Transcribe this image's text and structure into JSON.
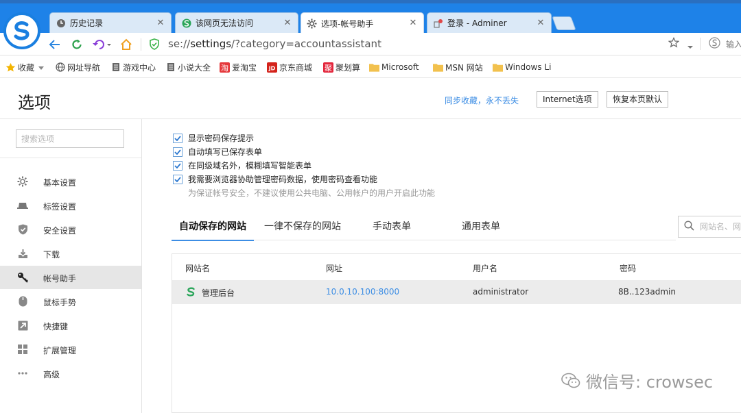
{
  "tabs": [
    {
      "title": "历史记录",
      "icon": "history-clock-icon",
      "active": false
    },
    {
      "title": "该网页无法访问",
      "icon": "sogou-s-icon",
      "active": false
    },
    {
      "title": "选项-帐号助手",
      "icon": "gear-icon",
      "active": true
    },
    {
      "title": "登录 - Adminer",
      "icon": "adminer-icon",
      "active": false
    }
  ],
  "address": {
    "scheme": "se://",
    "host": "settings",
    "path": "/?category=accountassistant"
  },
  "search_hint": "输入",
  "bookmarks": [
    {
      "label": "收藏",
      "icon": "star-icon"
    },
    {
      "label": "网址导航",
      "icon": "globe-icon"
    },
    {
      "label": "游戏中心",
      "icon": "page-icon"
    },
    {
      "label": "小说大全",
      "icon": "page-icon"
    },
    {
      "label": "爱淘宝",
      "icon": "taobao-icon"
    },
    {
      "label": "京东商城",
      "icon": "jd-icon"
    },
    {
      "label": "聚划算",
      "icon": "juhuasuan-icon"
    },
    {
      "label": "Microsoft",
      "icon": "folder-icon"
    },
    {
      "label": "MSN 网站",
      "icon": "folder-icon"
    },
    {
      "label": "Windows Li",
      "icon": "folder-icon"
    }
  ],
  "page": {
    "title": "选项",
    "sync_link": "同步收藏，永不丢失",
    "internet_options": "Internet选项",
    "restore_defaults": "恢复本页默认"
  },
  "sidebar": {
    "search_placeholder": "搜索选项",
    "items": [
      {
        "label": "基本设置",
        "icon": "gear-icon",
        "active": false
      },
      {
        "label": "标签设置",
        "icon": "tab-icon",
        "active": false
      },
      {
        "label": "安全设置",
        "icon": "shield-icon",
        "active": false
      },
      {
        "label": "下载",
        "icon": "download-icon",
        "active": false
      },
      {
        "label": "帐号助手",
        "icon": "key-icon",
        "active": true
      },
      {
        "label": "鼠标手势",
        "icon": "mouse-icon",
        "active": false
      },
      {
        "label": "快捷键",
        "icon": "shortcut-arrow-icon",
        "active": false
      },
      {
        "label": "扩展管理",
        "icon": "grid-icon",
        "active": false
      },
      {
        "label": "高级",
        "icon": "more-dots-icon",
        "active": false
      }
    ]
  },
  "options": [
    {
      "label": "显示密码保存提示",
      "checked": true
    },
    {
      "label": "自动填写已保存表单",
      "checked": true
    },
    {
      "label": "在同级域名外，模糊填写智能表单",
      "checked": true
    },
    {
      "label": "我需要浏览器协助管理密码数据，使用密码查看功能",
      "checked": true
    }
  ],
  "options_note": "为保证帐号安全，不建议使用公共电脑、公用帐户的用户开启此功能",
  "content_tabs": [
    {
      "label": "自动保存的网站",
      "active": true
    },
    {
      "label": "一律不保存的网站",
      "active": false
    },
    {
      "label": "手动表单",
      "active": false
    },
    {
      "label": "通用表单",
      "active": false
    }
  ],
  "site_search_placeholder": "网站名、网",
  "table": {
    "headers": [
      "网站名",
      "网址",
      "用户名",
      "密码"
    ],
    "rows": [
      {
        "site": "管理后台",
        "url": "10.0.10.100:8000",
        "user": "administrator",
        "password": "8B..123admin"
      }
    ]
  },
  "watermark": "微信号: crowsec",
  "colors": {
    "accent": "#1e82e8",
    "link": "#3c8de4"
  }
}
